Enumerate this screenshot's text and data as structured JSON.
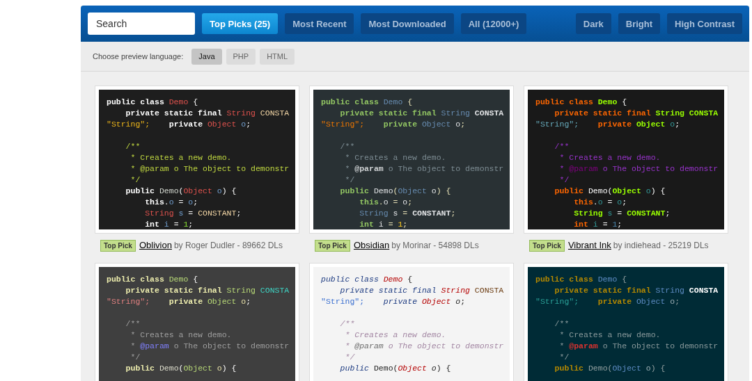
{
  "search": {
    "placeholder": "Search"
  },
  "filters": [
    {
      "label": "Top Picks (25)",
      "selected": true
    },
    {
      "label": "Most Recent",
      "selected": false
    },
    {
      "label": "Most Downloaded",
      "selected": false
    },
    {
      "label": "All (12000+)",
      "selected": false
    }
  ],
  "brightness": [
    {
      "label": "Dark",
      "selected": false
    },
    {
      "label": "Bright",
      "selected": false
    },
    {
      "label": "High Contrast",
      "selected": false
    }
  ],
  "language": {
    "label": "Choose preview language:",
    "options": [
      {
        "label": "Java",
        "selected": true
      },
      {
        "label": "PHP",
        "selected": false
      },
      {
        "label": "HTML",
        "selected": false
      }
    ]
  },
  "cards": [
    {
      "badge": "Top Pick",
      "name": "Oblivion",
      "author": "by Roger Dudler - 89662 DLs",
      "code": [
        {
          "tokens": [
            {
              "text": "public class ",
              "kind": "kw"
            },
            {
              "text": "Demo",
              "kind": "cls"
            },
            {
              "text": " {",
              "kind": "p"
            }
          ]
        },
        {
          "tokens": [
            {
              "text": "    private static final ",
              "kind": "kw"
            },
            {
              "text": "String",
              "kind": "type"
            },
            {
              "text": " CONSTA",
              "kind": "const"
            }
          ]
        },
        {
          "overlay": "\"String\";",
          "tokens": [
            {
              "text": "    private ",
              "kind": "kw"
            },
            {
              "text": "Object",
              "kind": "type"
            },
            {
              "text": " o",
              "kind": "var"
            },
            {
              "text": ";",
              "kind": "p"
            }
          ]
        },
        {
          "blank_before": true,
          "tokens": [
            {
              "text": "    /**",
              "kind": "cm"
            }
          ]
        },
        {
          "tokens": [
            {
              "text": "     * Creates a new demo.",
              "kind": "cm"
            }
          ]
        },
        {
          "tokens": [
            {
              "text": "     * ",
              "kind": "cm"
            },
            {
              "text": "@param",
              "kind": "tag"
            },
            {
              "text": " o The object to demonstr",
              "kind": "cm"
            }
          ]
        },
        {
          "tokens": [
            {
              "text": "     */",
              "kind": "cm"
            }
          ]
        },
        {
          "tokens": [
            {
              "text": "    public ",
              "kind": "kw"
            },
            {
              "text": "Demo",
              "kind": "ctor"
            },
            {
              "text": "(",
              "kind": "p"
            },
            {
              "text": "Object",
              "kind": "type"
            },
            {
              "text": " o",
              "kind": "var"
            },
            {
              "text": ") {",
              "kind": "p"
            }
          ]
        },
        {
          "tokens": [
            {
              "text": "        this",
              "kind": "kw"
            },
            {
              "text": ".",
              "kind": "p"
            },
            {
              "text": "o",
              "kind": "var"
            },
            {
              "text": " = ",
              "kind": "p"
            },
            {
              "text": "o",
              "kind": "var"
            },
            {
              "text": ";",
              "kind": "p"
            }
          ]
        },
        {
          "tokens": [
            {
              "text": "        String",
              "kind": "type"
            },
            {
              "text": " s",
              "kind": "var"
            },
            {
              "text": " = ",
              "kind": "p"
            },
            {
              "text": "CONSTANT",
              "kind": "const"
            },
            {
              "text": ";",
              "kind": "p"
            }
          ]
        },
        {
          "tokens": [
            {
              "text": "        int",
              "kind": "kw"
            },
            {
              "text": " i",
              "kind": "var"
            },
            {
              "text": " = ",
              "kind": "p"
            },
            {
              "text": "1",
              "kind": "num"
            },
            {
              "text": ";",
              "kind": "p"
            }
          ]
        }
      ]
    },
    {
      "badge": "Top Pick",
      "name": "Obsidian",
      "author": "by Morinar - 54898 DLs",
      "code": [
        {
          "tokens": [
            {
              "text": "public class ",
              "kind": "kw"
            },
            {
              "text": "Demo",
              "kind": "cls"
            },
            {
              "text": " {",
              "kind": "p"
            }
          ]
        },
        {
          "tokens": [
            {
              "text": "    private static final ",
              "kind": "kw"
            },
            {
              "text": "String",
              "kind": "type"
            },
            {
              "text": " CONSTA",
              "kind": "const"
            }
          ]
        },
        {
          "overlay": "\"String\";",
          "tokens": [
            {
              "text": "    private ",
              "kind": "kw"
            },
            {
              "text": "Object",
              "kind": "type"
            },
            {
              "text": " o",
              "kind": "var"
            },
            {
              "text": ";",
              "kind": "p"
            }
          ]
        },
        {
          "blank_before": true,
          "tokens": [
            {
              "text": "    /**",
              "kind": "cm"
            }
          ]
        },
        {
          "tokens": [
            {
              "text": "     * Creates a new demo.",
              "kind": "cm"
            }
          ]
        },
        {
          "tokens": [
            {
              "text": "     * ",
              "kind": "cm"
            },
            {
              "text": "@param",
              "kind": "tag"
            },
            {
              "text": " o The object to demonstr",
              "kind": "cm"
            }
          ]
        },
        {
          "tokens": [
            {
              "text": "     */",
              "kind": "cm"
            }
          ]
        },
        {
          "tokens": [
            {
              "text": "    public ",
              "kind": "kw"
            },
            {
              "text": "Demo",
              "kind": "ctor"
            },
            {
              "text": "(",
              "kind": "p"
            },
            {
              "text": "Object",
              "kind": "type"
            },
            {
              "text": " o",
              "kind": "var"
            },
            {
              "text": ") {",
              "kind": "p"
            }
          ]
        },
        {
          "tokens": [
            {
              "text": "        this",
              "kind": "kw"
            },
            {
              "text": ".",
              "kind": "p"
            },
            {
              "text": "o",
              "kind": "var"
            },
            {
              "text": " = ",
              "kind": "p"
            },
            {
              "text": "o",
              "kind": "var"
            },
            {
              "text": ";",
              "kind": "p"
            }
          ]
        },
        {
          "tokens": [
            {
              "text": "        String",
              "kind": "type"
            },
            {
              "text": " s",
              "kind": "var"
            },
            {
              "text": " = ",
              "kind": "p"
            },
            {
              "text": "CONSTANT",
              "kind": "const"
            },
            {
              "text": ";",
              "kind": "p"
            }
          ]
        },
        {
          "tokens": [
            {
              "text": "        int",
              "kind": "kw"
            },
            {
              "text": " i",
              "kind": "var"
            },
            {
              "text": " = ",
              "kind": "p"
            },
            {
              "text": "1",
              "kind": "num"
            },
            {
              "text": ";",
              "kind": "p"
            }
          ]
        }
      ]
    },
    {
      "badge": "Top Pick",
      "name": "Vibrant Ink",
      "author": "by indiehead - 25219 DLs",
      "code": [
        {
          "tokens": [
            {
              "text": "public class ",
              "kind": "kw"
            },
            {
              "text": "Demo",
              "kind": "cls"
            },
            {
              "text": " {",
              "kind": "p"
            }
          ]
        },
        {
          "tokens": [
            {
              "text": "    private static final ",
              "kind": "kw"
            },
            {
              "text": "String",
              "kind": "type"
            },
            {
              "text": " CONSTA",
              "kind": "const"
            }
          ]
        },
        {
          "overlay": "\"String\";",
          "tokens": [
            {
              "text": "    private ",
              "kind": "kw"
            },
            {
              "text": "Object",
              "kind": "type"
            },
            {
              "text": " o",
              "kind": "var"
            },
            {
              "text": ";",
              "kind": "p"
            }
          ]
        },
        {
          "blank_before": true,
          "tokens": [
            {
              "text": "    /**",
              "kind": "cm"
            }
          ]
        },
        {
          "tokens": [
            {
              "text": "     * Creates a new demo.",
              "kind": "cm"
            }
          ]
        },
        {
          "tokens": [
            {
              "text": "     * ",
              "kind": "cm"
            },
            {
              "text": "@param",
              "kind": "tag"
            },
            {
              "text": " o The object to demonstr",
              "kind": "cm"
            }
          ]
        },
        {
          "tokens": [
            {
              "text": "     */",
              "kind": "cm"
            }
          ]
        },
        {
          "tokens": [
            {
              "text": "    public ",
              "kind": "kw"
            },
            {
              "text": "Demo",
              "kind": "ctor"
            },
            {
              "text": "(",
              "kind": "p"
            },
            {
              "text": "Object",
              "kind": "type"
            },
            {
              "text": " o",
              "kind": "var"
            },
            {
              "text": ") {",
              "kind": "p"
            }
          ]
        },
        {
          "tokens": [
            {
              "text": "        this",
              "kind": "kw"
            },
            {
              "text": ".",
              "kind": "p"
            },
            {
              "text": "o",
              "kind": "var"
            },
            {
              "text": " = ",
              "kind": "p"
            },
            {
              "text": "o",
              "kind": "var"
            },
            {
              "text": ";",
              "kind": "p"
            }
          ]
        },
        {
          "tokens": [
            {
              "text": "        String",
              "kind": "type"
            },
            {
              "text": " s",
              "kind": "var"
            },
            {
              "text": " = ",
              "kind": "p"
            },
            {
              "text": "CONSTANT",
              "kind": "const"
            },
            {
              "text": ";",
              "kind": "p"
            }
          ]
        },
        {
          "tokens": [
            {
              "text": "        int",
              "kind": "kw"
            },
            {
              "text": " i",
              "kind": "var"
            },
            {
              "text": " = ",
              "kind": "p"
            },
            {
              "text": "1",
              "kind": "num"
            },
            {
              "text": ";",
              "kind": "p"
            }
          ]
        }
      ]
    },
    {
      "code": [
        {
          "tokens": [
            {
              "text": "public class ",
              "kind": "kw"
            },
            {
              "text": "Demo",
              "kind": "cls"
            },
            {
              "text": " {",
              "kind": "p"
            }
          ]
        },
        {
          "tokens": [
            {
              "text": "    private static final ",
              "kind": "kw"
            },
            {
              "text": "String",
              "kind": "type"
            },
            {
              "text": " CONSTA",
              "kind": "const"
            }
          ]
        },
        {
          "overlay": "\"String\";",
          "tokens": [
            {
              "text": "    private ",
              "kind": "kw"
            },
            {
              "text": "Object",
              "kind": "type"
            },
            {
              "text": " o",
              "kind": "var"
            },
            {
              "text": ";",
              "kind": "p"
            }
          ]
        },
        {
          "blank_before": true,
          "tokens": [
            {
              "text": "    /**",
              "kind": "cm"
            }
          ]
        },
        {
          "tokens": [
            {
              "text": "     * Creates a new demo.",
              "kind": "cm"
            }
          ]
        },
        {
          "tokens": [
            {
              "text": "     * ",
              "kind": "cm"
            },
            {
              "text": "@param",
              "kind": "tag"
            },
            {
              "text": " o The object to demonstr",
              "kind": "cm"
            }
          ]
        },
        {
          "tokens": [
            {
              "text": "     */",
              "kind": "cm"
            }
          ]
        },
        {
          "tokens": [
            {
              "text": "    public ",
              "kind": "kw"
            },
            {
              "text": "Demo",
              "kind": "ctor"
            },
            {
              "text": "(",
              "kind": "p"
            },
            {
              "text": "Object",
              "kind": "type"
            },
            {
              "text": " o",
              "kind": "var"
            },
            {
              "text": ") {",
              "kind": "p"
            }
          ]
        }
      ]
    },
    {
      "code": [
        {
          "tokens": [
            {
              "text": "public class ",
              "kind": "kw"
            },
            {
              "text": "Demo",
              "kind": "cls"
            },
            {
              "text": " {",
              "kind": "p"
            }
          ]
        },
        {
          "tokens": [
            {
              "text": "    private static final ",
              "kind": "kw"
            },
            {
              "text": "String",
              "kind": "type"
            },
            {
              "text": " CONSTA",
              "kind": "const"
            }
          ]
        },
        {
          "overlay": "\"String\";",
          "tokens": [
            {
              "text": "    private ",
              "kind": "kw"
            },
            {
              "text": "Object",
              "kind": "type"
            },
            {
              "text": " o",
              "kind": "var"
            },
            {
              "text": ";",
              "kind": "p"
            }
          ]
        },
        {
          "blank_before": true,
          "tokens": [
            {
              "text": "    /**",
              "kind": "cm"
            }
          ]
        },
        {
          "tokens": [
            {
              "text": "     * Creates a new demo.",
              "kind": "cm"
            }
          ]
        },
        {
          "tokens": [
            {
              "text": "     * ",
              "kind": "cm"
            },
            {
              "text": "@param",
              "kind": "tag"
            },
            {
              "text": " o The object to demonstr",
              "kind": "cm"
            }
          ]
        },
        {
          "tokens": [
            {
              "text": "     */",
              "kind": "cm"
            }
          ]
        },
        {
          "tokens": [
            {
              "text": "    public ",
              "kind": "kw"
            },
            {
              "text": "Demo",
              "kind": "ctor"
            },
            {
              "text": "(",
              "kind": "p"
            },
            {
              "text": "Object",
              "kind": "type"
            },
            {
              "text": " o",
              "kind": "var"
            },
            {
              "text": ") {",
              "kind": "p"
            }
          ]
        }
      ]
    },
    {
      "code": [
        {
          "tokens": [
            {
              "text": "public class ",
              "kind": "kw"
            },
            {
              "text": "Demo",
              "kind": "cls"
            },
            {
              "text": " {",
              "kind": "p"
            }
          ]
        },
        {
          "tokens": [
            {
              "text": "    private static final ",
              "kind": "kw"
            },
            {
              "text": "String",
              "kind": "type"
            },
            {
              "text": " CONSTA",
              "kind": "const"
            }
          ]
        },
        {
          "overlay": "\"String\";",
          "tokens": [
            {
              "text": "    private ",
              "kind": "kw"
            },
            {
              "text": "Object",
              "kind": "type"
            },
            {
              "text": " o",
              "kind": "var"
            },
            {
              "text": ";",
              "kind": "p"
            }
          ]
        },
        {
          "blank_before": true,
          "tokens": [
            {
              "text": "    /**",
              "kind": "cm"
            }
          ]
        },
        {
          "tokens": [
            {
              "text": "     * Creates a new demo.",
              "kind": "cm"
            }
          ]
        },
        {
          "tokens": [
            {
              "text": "     * ",
              "kind": "cm"
            },
            {
              "text": "@param",
              "kind": "tag"
            },
            {
              "text": " o The object to demonstr",
              "kind": "cm"
            }
          ]
        },
        {
          "tokens": [
            {
              "text": "     */",
              "kind": "cm"
            }
          ]
        },
        {
          "tokens": [
            {
              "text": "    public ",
              "kind": "kw"
            },
            {
              "text": "Demo",
              "kind": "ctor"
            },
            {
              "text": "(",
              "kind": "p"
            },
            {
              "text": "Object",
              "kind": "type"
            },
            {
              "text": " o",
              "kind": "var"
            },
            {
              "text": ") {",
              "kind": "p"
            }
          ]
        }
      ]
    }
  ]
}
